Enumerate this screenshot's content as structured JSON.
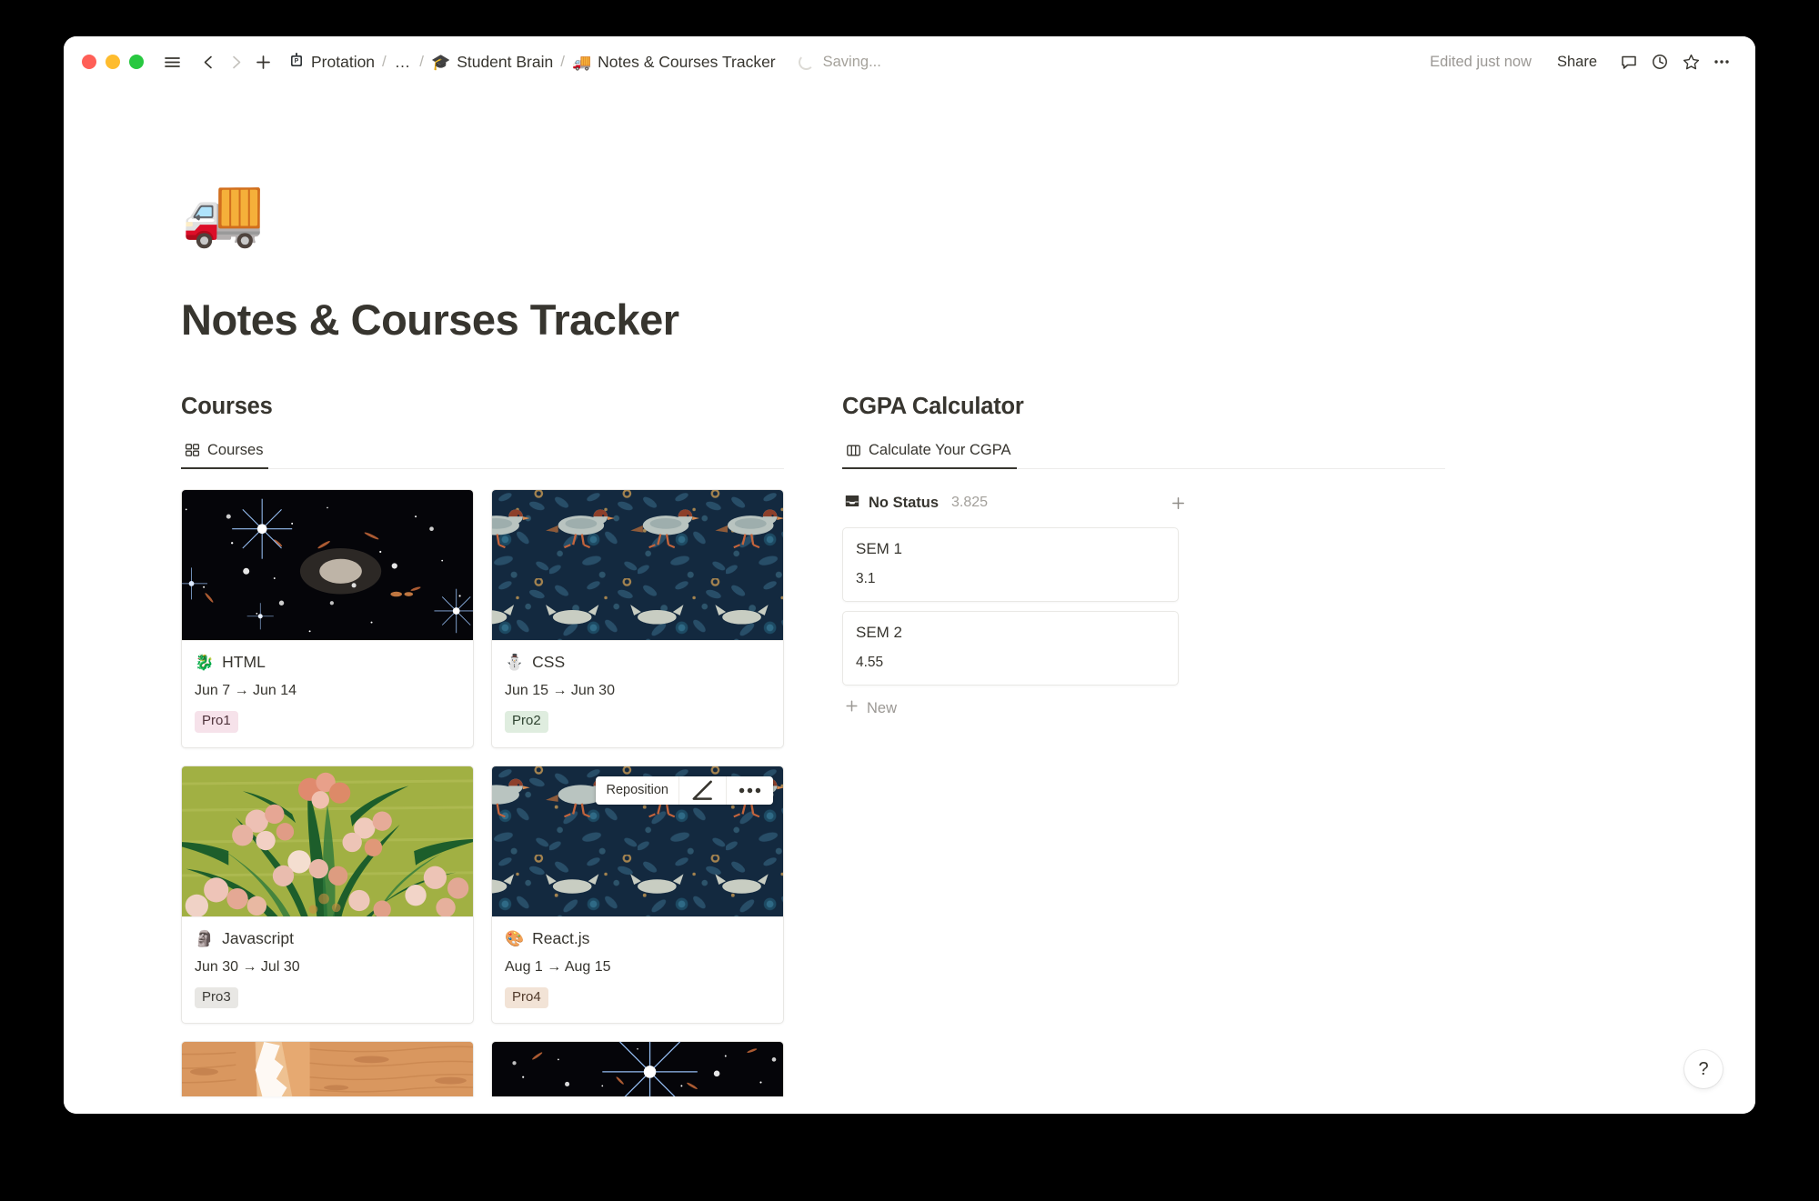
{
  "window": {
    "traffic_lights": [
      "close",
      "minimize",
      "maximize"
    ],
    "breadcrumb": {
      "workspace_label": "Protation",
      "ellipsis": "…",
      "parent_emoji": "🎓",
      "parent_label": "Student Brain",
      "current_emoji": "🚚",
      "current_label": "Notes & Courses Tracker",
      "separator": "/"
    },
    "saving_status": "Saving...",
    "edited_status": "Edited just now",
    "share_label": "Share"
  },
  "page": {
    "emoji": "🚚",
    "title": "Notes & Courses Tracker"
  },
  "courses_section": {
    "heading": "Courses",
    "tab_label": "Courses",
    "tab_icon": "gallery-icon",
    "cards": [
      {
        "emoji": "🐉",
        "title": "HTML",
        "date": "Jun 7 → Jun 14",
        "tag": "Pro1",
        "tag_color": "pink",
        "cover": "jwst-deep-field"
      },
      {
        "emoji": "⛄",
        "title": "CSS",
        "date": "Jun 15 → Jun 30",
        "tag": "Pro2",
        "tag_color": "green",
        "cover": "morris-birds"
      },
      {
        "emoji": "🗿",
        "title": "Javascript",
        "date": "Jun 30 → Jul 30",
        "tag": "Pro3",
        "tag_color": "gray",
        "cover": "van-gogh-oleanders"
      },
      {
        "emoji": "🎨",
        "title": "React.js",
        "date": "Aug 1 → Aug 15",
        "tag": "Pro4",
        "tag_color": "orange",
        "cover": "morris-birds"
      },
      {
        "emoji": "",
        "title": "",
        "date": "",
        "tag": "",
        "tag_color": "gray",
        "cover": "canyon"
      },
      {
        "emoji": "",
        "title": "",
        "date": "",
        "tag": "",
        "tag_color": "gray",
        "cover": "jwst-star"
      }
    ],
    "reposition": {
      "label": "Reposition",
      "resize_icon": "resize-angle-icon",
      "more_icon": "more-horizontal-icon"
    }
  },
  "cgpa_section": {
    "heading": "CGPA Calculator",
    "tab_label": "Calculate Your CGPA",
    "tab_icon": "board-icon",
    "column": {
      "icon": "inbox-icon",
      "name": "No Status",
      "count": "3.825",
      "add_icon": "plus-icon"
    },
    "cards": [
      {
        "title": "SEM 1",
        "value": "3.1"
      },
      {
        "title": "SEM 2",
        "value": "4.55"
      }
    ],
    "new_label": "New"
  },
  "help": {
    "label": "?"
  },
  "colors": {
    "text": "#37352f",
    "muted": "#9b9894",
    "border": "#e8e7e4",
    "accent_pink": "#f6e2ea",
    "accent_green": "#dfeddf",
    "accent_gray": "#e8e7e4",
    "accent_orange": "#f2e3d6",
    "traffic_red": "#ff5f57",
    "traffic_yellow": "#febc2e",
    "traffic_green": "#28c840"
  }
}
